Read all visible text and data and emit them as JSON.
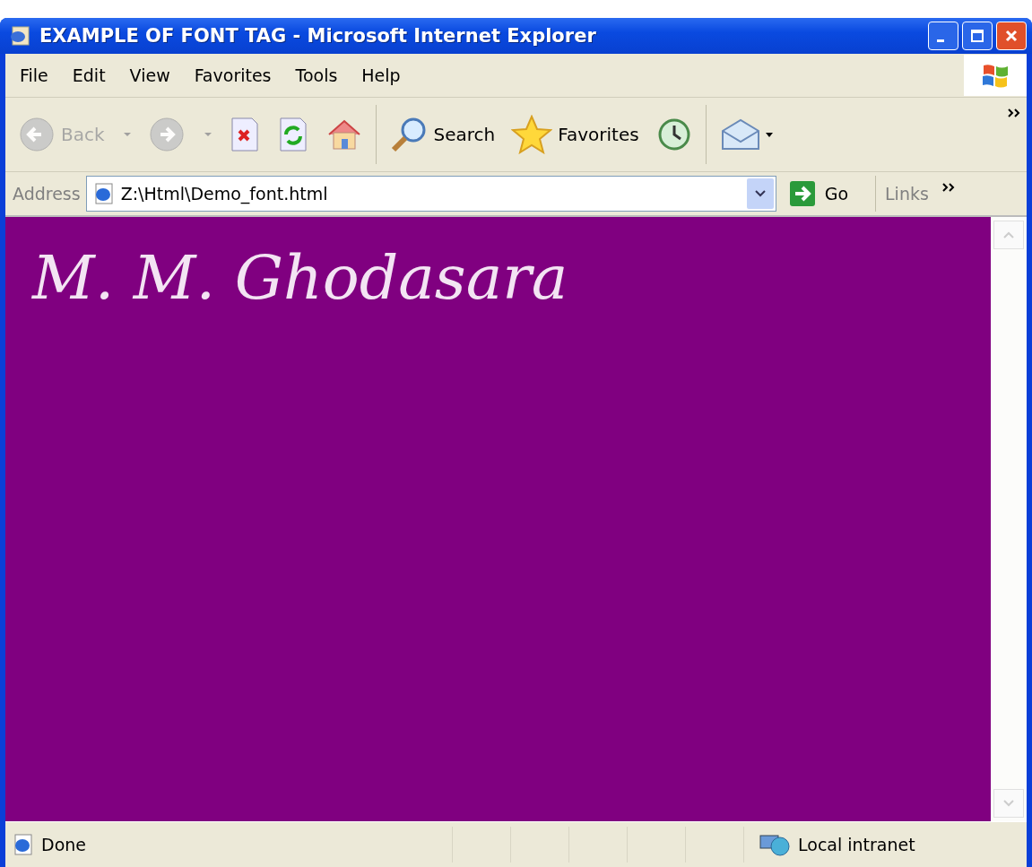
{
  "window": {
    "title": "EXAMPLE OF FONT TAG - Microsoft Internet Explorer"
  },
  "menu": [
    "File",
    "Edit",
    "View",
    "Favorites",
    "Tools",
    "Help"
  ],
  "toolbar": [
    {
      "kind": "back",
      "label": "Back",
      "disabled": true
    },
    {
      "kind": "forward",
      "disabled": true
    },
    {
      "kind": "stop",
      "disabled": false
    },
    {
      "kind": "refresh",
      "disabled": false
    },
    {
      "kind": "home",
      "disabled": false
    },
    {
      "kind": "search",
      "label": "Search",
      "disabled": false
    },
    {
      "kind": "favorites",
      "label": "Favorites",
      "disabled": false
    },
    {
      "kind": "history",
      "disabled": false
    },
    {
      "kind": "mail",
      "disabled": false
    }
  ],
  "address_bar": {
    "label": "Address",
    "value": "Z:\\Html\\Demo_font.html",
    "go": "Go",
    "links": "Links"
  },
  "page": {
    "heading": "M. M. Ghodasara"
  },
  "status_bar": {
    "status": "Done",
    "zone": "Local intranet"
  }
}
